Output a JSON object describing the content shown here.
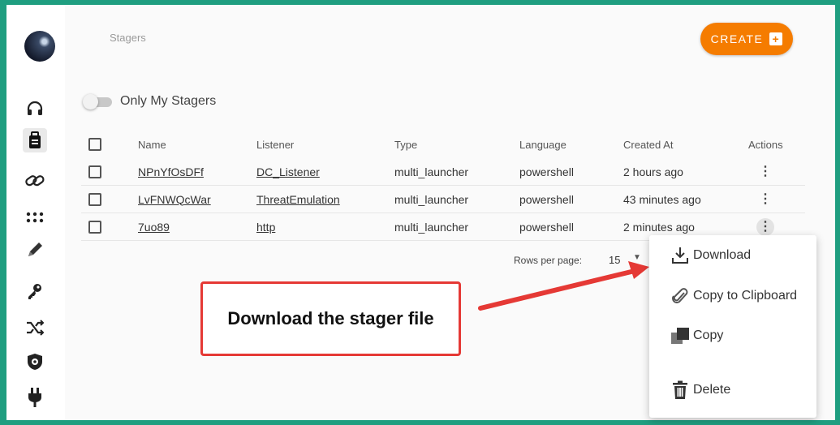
{
  "header": {
    "breadcrumb": "Stagers",
    "create_label": "CREATE",
    "create_icon": "plus-box-icon"
  },
  "sidebar": {
    "items": [
      {
        "name": "headphones-icon"
      },
      {
        "name": "briefcase-icon",
        "active": true
      },
      {
        "name": "link-icon"
      },
      {
        "name": "dots-grid-icon"
      },
      {
        "name": "pencil-icon"
      },
      {
        "name": "key-icon"
      },
      {
        "name": "shuffle-icon"
      },
      {
        "name": "shield-gear-icon"
      },
      {
        "name": "plug-icon"
      }
    ]
  },
  "filter": {
    "label": "Only My Stagers",
    "enabled": false
  },
  "table": {
    "columns": [
      "Name",
      "Listener",
      "Type",
      "Language",
      "Created At",
      "Actions"
    ],
    "rows": [
      {
        "name": "NPnYfOsDFf",
        "listener": "DC_Listener",
        "type": "multi_launcher",
        "language": "powershell",
        "created": "2 hours ago"
      },
      {
        "name": "LvFNWQcWar",
        "listener": "ThreatEmulation",
        "type": "multi_launcher",
        "language": "powershell",
        "created": "43 minutes ago"
      },
      {
        "name": "7uo89",
        "listener": "http",
        "type": "multi_launcher",
        "language": "powershell",
        "created": "2 minutes ago"
      }
    ]
  },
  "pagination": {
    "rows_per_page_label": "Rows per page:",
    "rows_per_page": "15"
  },
  "context_menu": {
    "items": [
      {
        "label": "Download",
        "icon": "download-icon"
      },
      {
        "label": "Copy to Clipboard",
        "icon": "paperclip-icon"
      },
      {
        "label": "Copy",
        "icon": "copy-icon"
      },
      {
        "label": "Delete",
        "icon": "trash-icon"
      }
    ]
  },
  "annotation": {
    "text": "Download the stager file"
  },
  "colors": {
    "frame": "#1f9e80",
    "accent": "#f57c00",
    "annotation": "#e53935"
  }
}
